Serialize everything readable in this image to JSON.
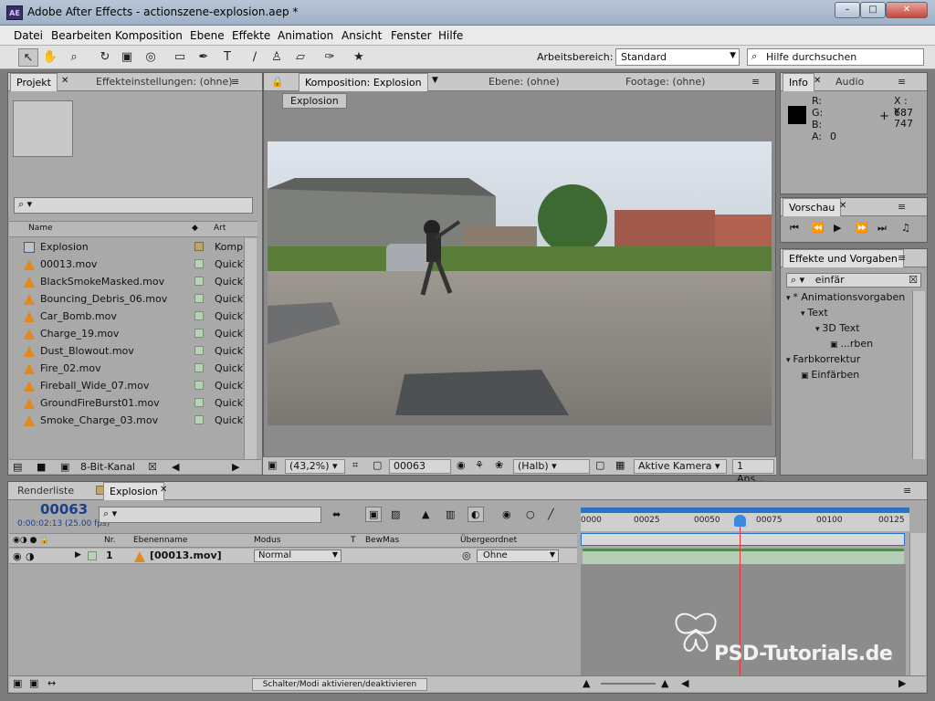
{
  "window": {
    "title": "Adobe After Effects - actionszene-explosion.aep *",
    "app_icon": "AE"
  },
  "menu": [
    "Datei",
    "Bearbeiten",
    "Komposition",
    "Ebene",
    "Effekte",
    "Animation",
    "Ansicht",
    "Fenster",
    "Hilfe"
  ],
  "toolbar": {
    "workspace_label": "Arbeitsbereich:",
    "workspace_value": "Standard",
    "help_placeholder": "Hilfe durchsuchen",
    "tools": [
      "selection-tool-icon",
      "hand-tool-icon",
      "zoom-tool-icon",
      "rotate-tool-icon",
      "camera-tool-icon",
      "pan-behind-tool-icon",
      "rectangle-tool-icon",
      "pen-tool-icon",
      "text-tool-icon",
      "brush-tool-icon",
      "clone-stamp-tool-icon",
      "eraser-tool-icon",
      "roto-brush-tool-icon",
      "puppet-pin-tool-icon"
    ]
  },
  "project": {
    "tabs": [
      "Projekt",
      "Effekteinstellungen: (ohne)"
    ],
    "col_name": "Name",
    "col_type": "Art",
    "items": [
      {
        "name": "Explosion",
        "type": "Komp",
        "kind": "comp"
      },
      {
        "name": "00013.mov",
        "type": "QuickT",
        "kind": "footage"
      },
      {
        "name": "BlackSmokeMasked.mov",
        "type": "QuickT",
        "kind": "footage"
      },
      {
        "name": "Bouncing_Debris_06.mov",
        "type": "QuickT",
        "kind": "footage"
      },
      {
        "name": "Car_Bomb.mov",
        "type": "QuickT",
        "kind": "footage"
      },
      {
        "name": "Charge_19.mov",
        "type": "QuickT",
        "kind": "footage"
      },
      {
        "name": "Dust_Blowout.mov",
        "type": "QuickT",
        "kind": "footage"
      },
      {
        "name": "Fire_02.mov",
        "type": "QuickT",
        "kind": "footage"
      },
      {
        "name": "Fireball_Wide_07.mov",
        "type": "QuickT",
        "kind": "footage"
      },
      {
        "name": "GroundFireBurst01.mov",
        "type": "QuickT",
        "kind": "footage"
      },
      {
        "name": "Smoke_Charge_03.mov",
        "type": "QuickT",
        "kind": "footage"
      }
    ],
    "bit_depth": "8-Bit-Kanal"
  },
  "composition": {
    "tabs": [
      "Komposition: Explosion",
      "Ebene: (ohne)",
      "Footage: (ohne)"
    ],
    "breadcrumb": "Explosion",
    "zoom": "(43,2%)",
    "timecode": "00063",
    "resolution": "(Halb)",
    "camera": "Aktive Kamera",
    "views": "1 Ans..."
  },
  "info": {
    "tabs": [
      "Info",
      "Audio"
    ],
    "r": "R:",
    "g": "G:",
    "b": "B:",
    "a": "A:",
    "a_val": "0",
    "x": "X : 687",
    "y": "Y : 747"
  },
  "preview": {
    "title": "Vorschau"
  },
  "effects": {
    "title": "Effekte und Vorgaben",
    "search": "einfär",
    "tree": [
      {
        "label": "* Animationsvorgaben",
        "level": 0
      },
      {
        "label": "Text",
        "level": 1
      },
      {
        "label": "3D Text",
        "level": 2
      },
      {
        "label": "...rben",
        "level": 3
      },
      {
        "label": "Farbkorrektur",
        "level": 0
      },
      {
        "label": "Einfärben",
        "level": 1
      }
    ]
  },
  "timeline": {
    "tabs": [
      "Renderliste",
      "Explosion"
    ],
    "timecode": "00063",
    "subtime": "0:00:02:13 (25.00 fps)",
    "columns": {
      "nr": "Nr.",
      "name": "Ebenenname",
      "mode": "Modus",
      "t": "T",
      "trkmat": "BewMas",
      "parent": "Übergeordnet"
    },
    "layer": {
      "number": "1",
      "name": "[00013.mov]",
      "mode": "Normal",
      "parent": "Ohne"
    },
    "ruler": [
      "0000",
      "00025",
      "00050",
      "00075",
      "00100",
      "00125"
    ],
    "switch_label": "Schalter/Modi aktivieren/deaktivieren"
  },
  "watermark": "PSD-Tutorials.de"
}
